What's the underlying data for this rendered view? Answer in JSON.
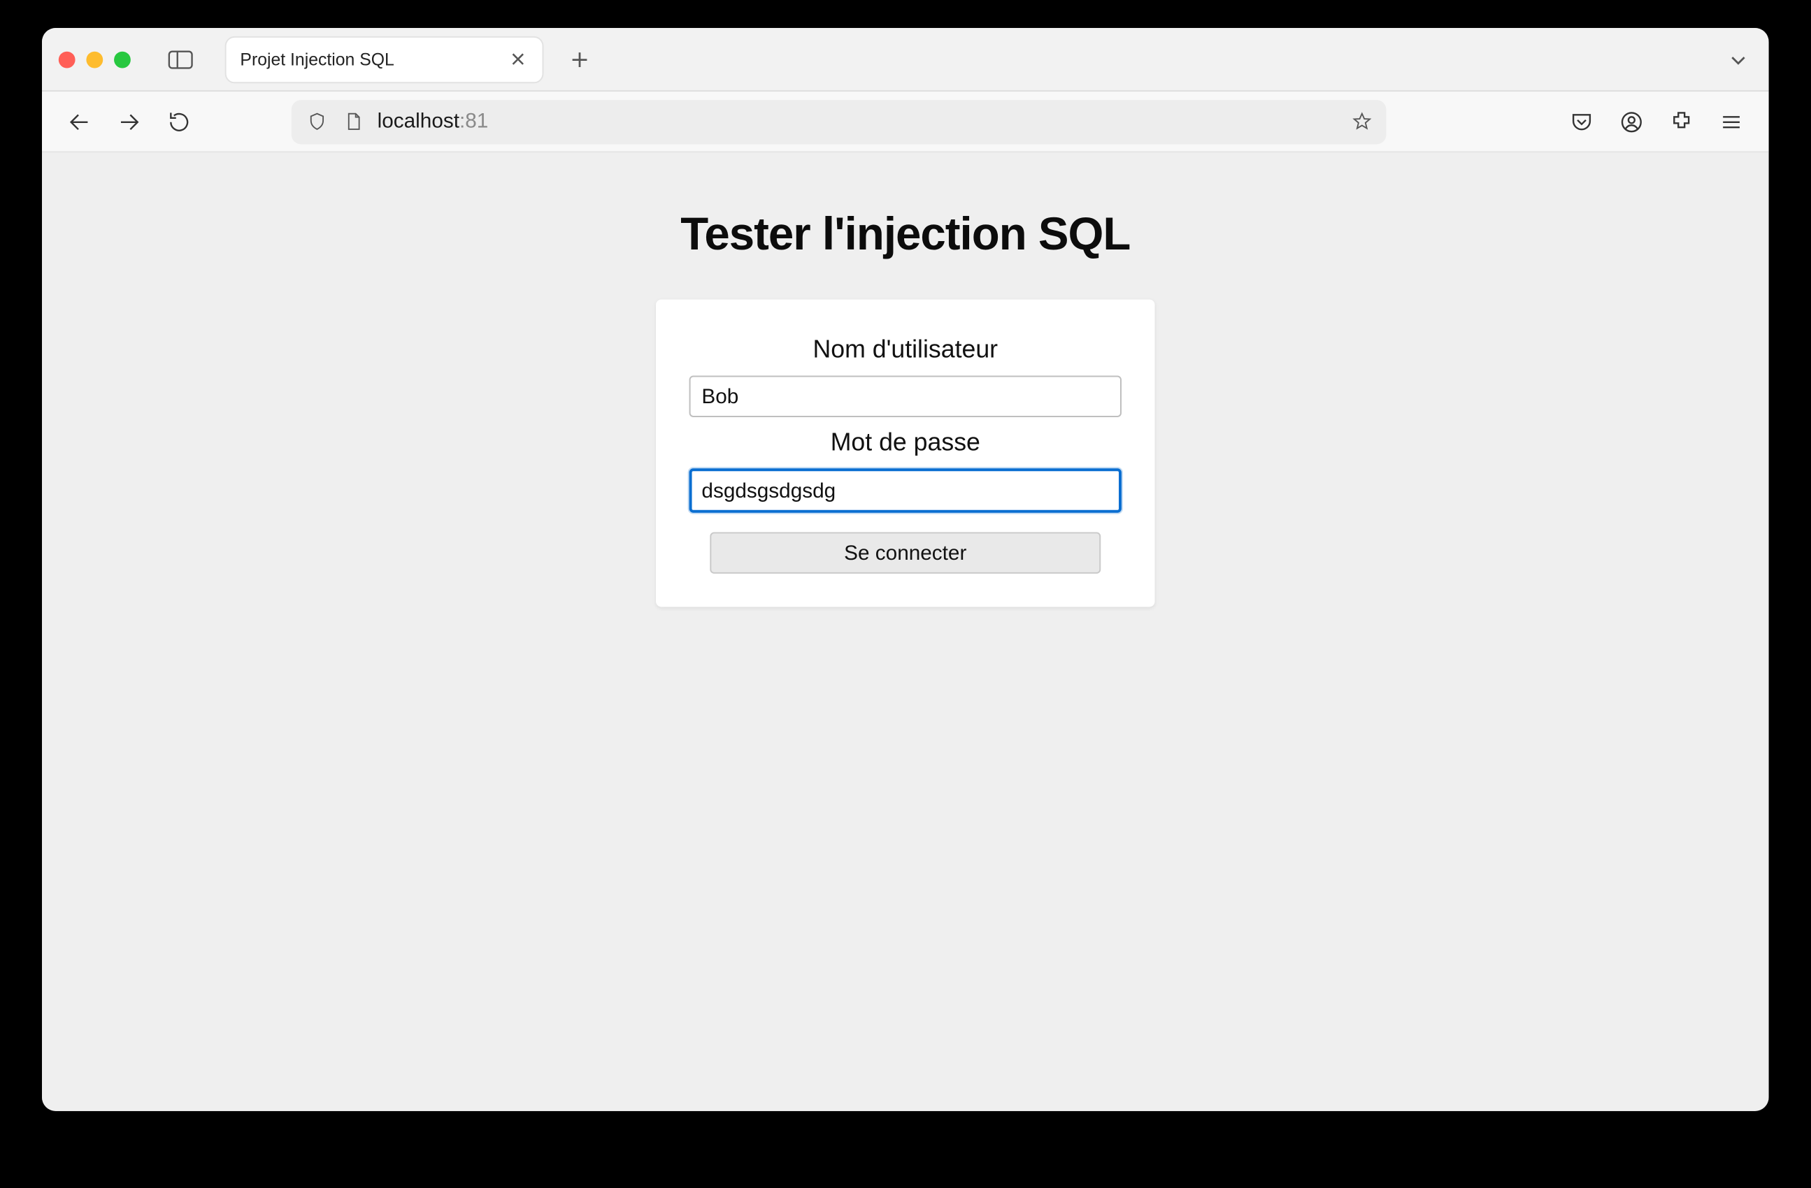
{
  "browser": {
    "tab_title": "Projet Injection SQL",
    "url_host": "localhost",
    "url_port": ":81"
  },
  "page": {
    "heading": "Tester l'injection SQL",
    "username_label": "Nom d'utilisateur",
    "username_value": "Bob",
    "password_label": "Mot de passe",
    "password_value": "dsgdsgsdgsdg",
    "submit_label": "Se connecter"
  }
}
